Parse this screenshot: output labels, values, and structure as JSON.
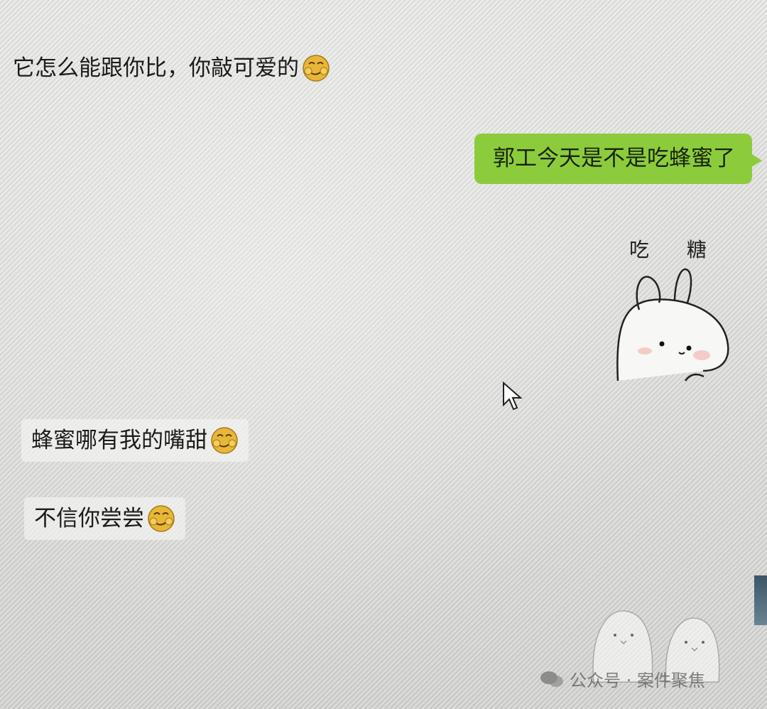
{
  "messages": [
    {
      "side": "in",
      "text": "它怎么能跟你比，你敲可爱的",
      "emoji": "smirk-emoji"
    },
    {
      "side": "out",
      "text": "郭工今天是不是吃蜂蜜了"
    },
    {
      "side": "in",
      "sticker": "rabbit-sticker",
      "caption": "吃 糖"
    },
    {
      "side": "in",
      "text": "蜂蜜哪有我的嘴甜",
      "emoji": "smirk-emoji"
    },
    {
      "side": "in",
      "text": "不信你尝尝",
      "emoji": "smirk-emoji"
    }
  ],
  "watermark": {
    "text": "公众号 · 案件聚焦"
  },
  "colors": {
    "out_bubble": "#8ccc3c",
    "background": "#e4e4e2"
  }
}
